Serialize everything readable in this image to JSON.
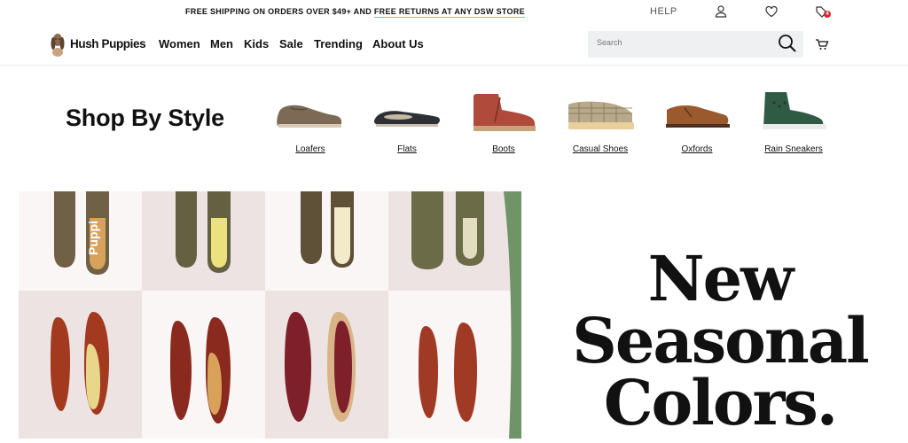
{
  "topbar": {
    "promo_left": "FREE SHIPPING ON ORDERS OVER $49+ AND",
    "promo_right": "FREE RETURNS AT ANY DSW STORE",
    "help": "HELP",
    "bag_count": "4"
  },
  "brand": {
    "name": "Hush Puppies"
  },
  "nav": {
    "items": [
      "Women",
      "Men",
      "Kids",
      "Sale",
      "Trending",
      "About Us"
    ]
  },
  "search": {
    "placeholder": "Search"
  },
  "shop_by_style": {
    "title": "Shop By Style",
    "items": [
      "Loafers",
      "Flats",
      "Boots",
      "Casual Shoes",
      "Oxfords",
      "Rain Sneakers"
    ]
  },
  "hero": {
    "headline": [
      "New",
      "Seasonal",
      "Colors."
    ],
    "tile_brand_text": "Puppi",
    "accent_color": "#6f9468"
  }
}
